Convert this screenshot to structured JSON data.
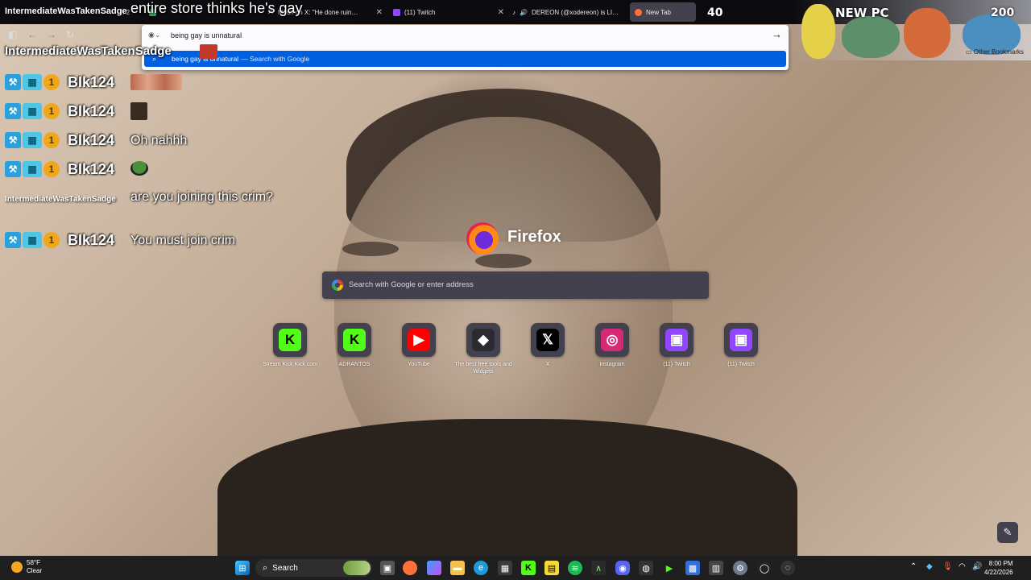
{
  "browser": {
    "tabs": [
      {
        "label": "IntermediateWasTakenSadge",
        "partial": "h 2"
      },
      {
        "label": "",
        "color": "#3ba55c"
      },
      {
        "label": "Mesh​ on X: \"He done ruin…",
        "color": "#000000"
      },
      {
        "label": "(11) Twitch",
        "color": "#9146ff"
      },
      {
        "label": "DEREON (@xodereon) is LI…",
        "color": "#000000"
      },
      {
        "label": "New Tab",
        "color": "#ff7139"
      }
    ],
    "address_query": "being gay is unnatural",
    "suggestion": {
      "text": "being gay is unnatural",
      "hint": "— Search with Google"
    },
    "go_icon": "arrow-right-icon",
    "other_bookmarks": "Other Bookmarks"
  },
  "overlay": {
    "counter_a": "40",
    "counter_b": "200",
    "new_pc": "NEW PC"
  },
  "chat": {
    "streamer": "IntermediateWasTakenSadge",
    "top_user": "IntermediateWasTakenSadge",
    "top_message": "entire store thinks he's gay",
    "rows": [
      {
        "user": "BIk124",
        "coin": "1",
        "message": "",
        "emote": true
      },
      {
        "user": "BIk124",
        "coin": "1",
        "message": "",
        "emote": true
      },
      {
        "user": "BIk124",
        "coin": "1",
        "message": "Oh nahhh",
        "emote": false
      },
      {
        "user": "BIk124",
        "coin": "1",
        "message": "",
        "emote": true
      },
      {
        "user": "IntermediateWasTakenSadge",
        "coin": "",
        "message": "are you joining this crim?",
        "emote": false
      },
      {
        "user": "BIk124",
        "coin": "1",
        "message": "You must join crim",
        "emote": false
      }
    ]
  },
  "newtab": {
    "brand": "Firefox",
    "search_placeholder": "Search with Google or enter address",
    "shortcuts": [
      {
        "label": "Stream Kick Kick.com",
        "icon": "kick-icon",
        "glyph": "K",
        "bg": "#53fc18",
        "fg": "#000000"
      },
      {
        "label": "ADRANTOS",
        "icon": "kick-icon",
        "glyph": "K",
        "bg": "#53fc18",
        "fg": "#000000"
      },
      {
        "label": "YouTube",
        "icon": "youtube-icon",
        "glyph": "▶",
        "bg": "#ff0000",
        "fg": "#ffffff"
      },
      {
        "label": "The best free tools and Widgets",
        "icon": "diamond-icon",
        "glyph": "◆",
        "bg": "#2b2a33",
        "fg": "#ffffff"
      },
      {
        "label": "X",
        "icon": "x-icon",
        "glyph": "𝕏",
        "bg": "#000000",
        "fg": "#ffffff"
      },
      {
        "label": "Instagram",
        "icon": "instagram-icon",
        "glyph": "◎",
        "bg": "#d62976",
        "fg": "#ffffff"
      },
      {
        "label": "(11) Twitch",
        "icon": "twitch-icon",
        "glyph": "▣",
        "bg": "#9146ff",
        "fg": "#ffffff"
      },
      {
        "label": "(11) Twitch",
        "icon": "twitch-icon",
        "glyph": "▣",
        "bg": "#9146ff",
        "fg": "#ffffff"
      }
    ]
  },
  "taskbar": {
    "weather_temp": "58°F",
    "weather_desc": "Clear",
    "search_label": "Search",
    "time": "8:00 PM",
    "date": "4/22/2026"
  }
}
